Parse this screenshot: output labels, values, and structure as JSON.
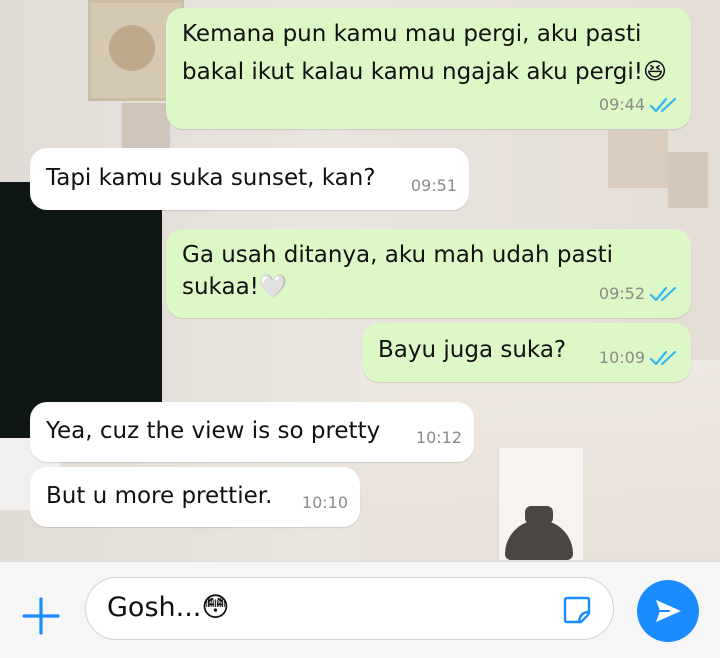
{
  "messages": [
    {
      "direction": "out",
      "line1": "Kemana pun kamu mau pergi, aku pasti",
      "line2": "bakal ikut kalau kamu ngajak aku pergi!😆",
      "time": "09:44",
      "status": "read"
    },
    {
      "direction": "in",
      "line1": "Tapi kamu suka sunset, kan?",
      "time": "09:51"
    },
    {
      "direction": "out",
      "line1": "Ga usah ditanya, aku mah udah pasti",
      "line2": "sukaa!🤍",
      "time": "09:52",
      "status": "read"
    },
    {
      "direction": "out",
      "line1": "Bayu juga suka?",
      "time": "10:09",
      "status": "read"
    },
    {
      "direction": "in",
      "line1": "Yea, cuz the view is so pretty",
      "time": "10:12"
    },
    {
      "direction": "in",
      "line1": "But u more prettier.",
      "time": "10:10"
    }
  ],
  "composer": {
    "text": "Gosh...😳"
  },
  "colors": {
    "outgoing_bubble": "#dcf8c6",
    "incoming_bubble": "#ffffff",
    "read_ticks": "#34b7f1",
    "accent": "#1a8cff"
  },
  "icons": {
    "attach": "plus-icon",
    "sticker": "sticker-icon",
    "send": "send-icon",
    "read_receipt": "double-check-icon"
  }
}
